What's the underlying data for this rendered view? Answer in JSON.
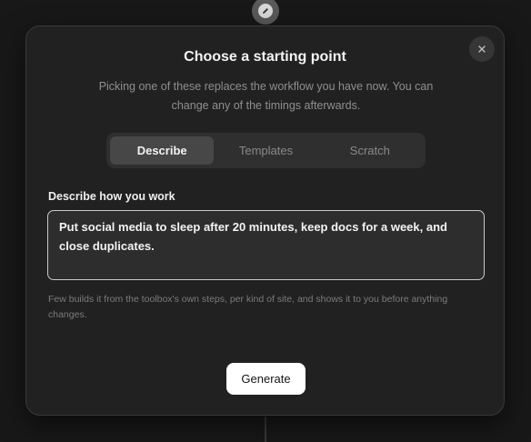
{
  "background": {
    "node_icon": "pencil-icon"
  },
  "modal": {
    "close_glyph": "×",
    "title": "Choose a starting point",
    "subtitle": "Picking one of these replaces the workflow you have now. You can change any of the timings afterwards.",
    "tabs": [
      {
        "label": "Describe",
        "active": true
      },
      {
        "label": "Templates",
        "active": false
      },
      {
        "label": "Scratch",
        "active": false
      }
    ],
    "field_label": "Describe how you work",
    "textarea_value": "Put social media to sleep after 20 minutes, keep docs for a week, and close duplicates.",
    "hint": "Few builds it from the toolbox's own steps, per kind of site, and shows it to you before anything changes.",
    "generate_label": "Generate"
  },
  "colors": {
    "modal_bg": "#212121",
    "tab_active_bg": "#474747",
    "primary_button_bg": "#ffffff"
  }
}
